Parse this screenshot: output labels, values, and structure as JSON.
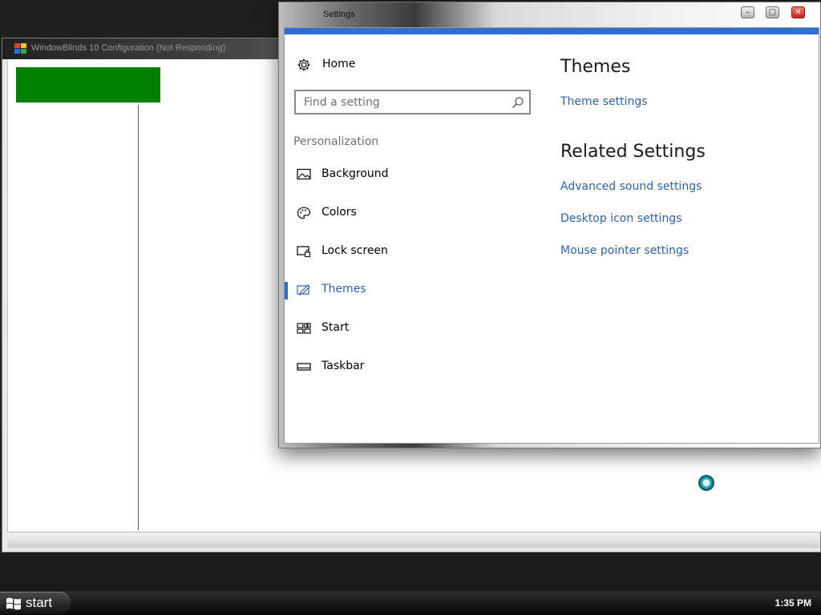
{
  "background_window": {
    "title": "WindowBlinds 10 Configuration (Not Responding)",
    "colors": {
      "panel": "#007f00",
      "divider": "#3b5ba7"
    }
  },
  "settings_window": {
    "title": "Settings",
    "caption_buttons": {
      "minimize": "minimize-icon",
      "maximize": "maximize-icon",
      "close": "close-icon"
    },
    "home_label": "Home",
    "search": {
      "placeholder": "Find a setting",
      "value": ""
    },
    "section": "Personalization",
    "nav_items": [
      {
        "label": "Background",
        "icon": "picture-icon",
        "active": false
      },
      {
        "label": "Colors",
        "icon": "palette-icon",
        "active": false
      },
      {
        "label": "Lock screen",
        "icon": "lock-screen-icon",
        "active": false
      },
      {
        "label": "Themes",
        "icon": "brush-icon",
        "active": true
      },
      {
        "label": "Start",
        "icon": "start-tiles-icon",
        "active": false
      },
      {
        "label": "Taskbar",
        "icon": "taskbar-icon",
        "active": false
      }
    ],
    "content": {
      "title": "Themes",
      "theme_link": "Theme settings",
      "related_title": "Related Settings",
      "related_links": [
        "Advanced sound settings",
        "Desktop icon settings",
        "Mouse pointer settings"
      ]
    },
    "colors": {
      "accent": "#2f6fd4",
      "link": "#2a64b0"
    }
  },
  "taskbar": {
    "start_label": "start",
    "clock": "1:35 PM"
  }
}
